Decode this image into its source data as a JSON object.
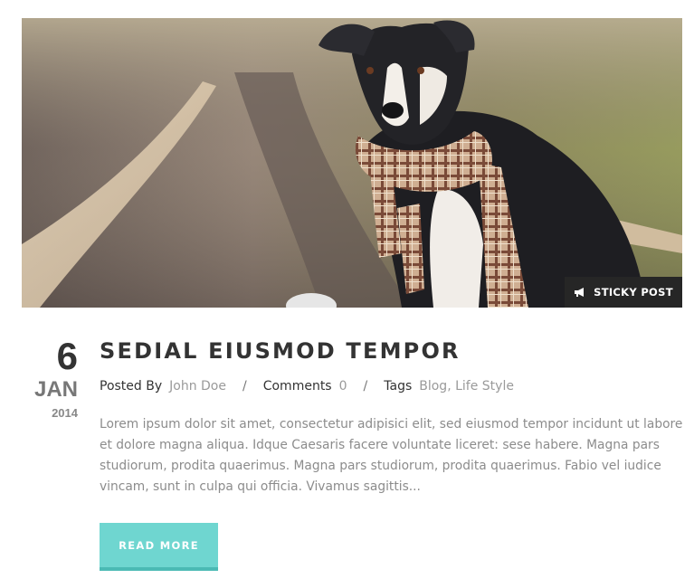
{
  "post": {
    "image": {
      "alt": "dog wearing plaid scarf on railway tracks",
      "colors": {
        "track_light": "#d9c6a8",
        "track_dark": "#6e5e56",
        "grass": "#8a9a4a",
        "dog": "#1f1f24"
      }
    },
    "sticky_label": "STICKY POST",
    "sticky_icon": "megaphone-icon",
    "date": {
      "day": "6",
      "month": "JAN",
      "year": "2014"
    },
    "title": "SEDIAL EIUSMOD TEMPOR",
    "meta": {
      "posted_by_label": "Posted By",
      "author": "John Doe",
      "separator": "/",
      "comments_label": "Comments",
      "comments_count": "0",
      "tags_label": "Tags",
      "tags": "Blog, Life Style"
    },
    "excerpt": "Lorem ipsum dolor sit amet, consectetur adipisici elit, sed eiusmod tempor incidunt ut labore et dolore magna aliqua. Idque Caesaris facere voluntate liceret: sese habere. Magna pars studiorum, prodita quaerimus. Magna pars studiorum, prodita quaerimus. Fabio vel iudice vincam, sunt in culpa qui officia. Vivamus sagittis...",
    "read_more_label": "READ MORE",
    "accent_color": "#6fd6d0"
  }
}
